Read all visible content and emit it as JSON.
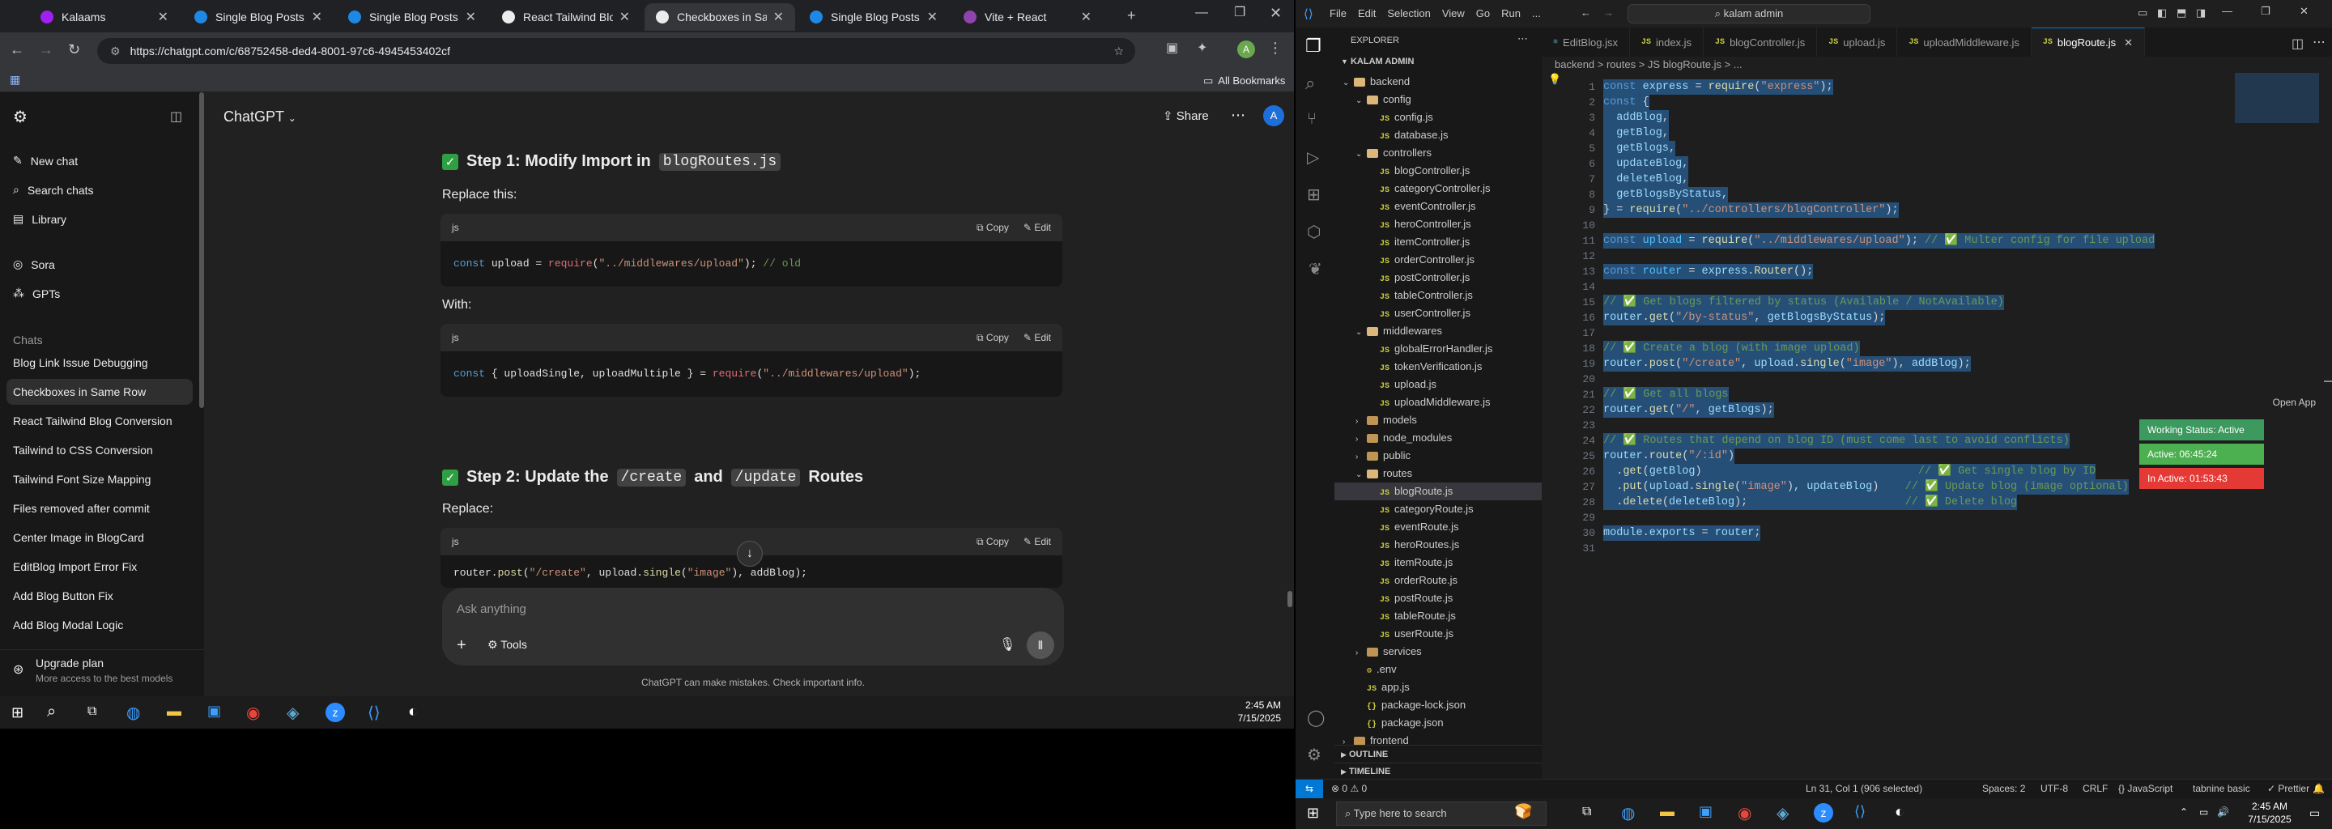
{
  "chrome": {
    "tabs": [
      {
        "label": "Kalaams",
        "color": "#a020f0"
      },
      {
        "label": "Single Blog Posts Pag",
        "color": "#1e88e5"
      },
      {
        "label": "Single Blog Posts Pag",
        "color": "#1e88e5"
      },
      {
        "label": "React Tailwind Blog Co",
        "color": "#ececec"
      },
      {
        "label": "Checkboxes in Same R",
        "color": "#ececec"
      },
      {
        "label": "Single Blog Posts Pag",
        "color": "#1e88e5"
      },
      {
        "label": "Vite + React",
        "color": "#8e44ad"
      }
    ],
    "url": "https://chatgpt.com/c/68752458-ded4-8001-97c6-4945453402cf",
    "all_bookmarks": "All Bookmarks",
    "profile_initial": "A"
  },
  "chatgpt": {
    "sidebar": {
      "new_chat": "New chat",
      "search_chats": "Search chats",
      "library": "Library",
      "sora": "Sora",
      "gpts": "GPTs",
      "chats_heading": "Chats",
      "chats": [
        "Blog Link Issue Debugging",
        "Checkboxes in Same Row",
        "React Tailwind Blog Conversion",
        "Tailwind to CSS Conversion",
        "Tailwind Font Size Mapping",
        "Files removed after commit",
        "Center Image in BlogCard",
        "EditBlog Import Error Fix",
        "Add Blog Button Fix",
        "Add Blog Modal Logic"
      ],
      "upgrade_title": "Upgrade plan",
      "upgrade_sub": "More access to the best models"
    },
    "header": {
      "model": "ChatGPT",
      "share": "Share",
      "avatar": "A"
    },
    "content": {
      "step1_prefix": "Step 1: Modify Import in",
      "step1_code": "blogRoutes.js",
      "replace_this": "Replace this:",
      "with": "With:",
      "step2_prefix": "Step 2: Update the",
      "step2_code1": "/create",
      "step2_and": "and",
      "step2_code2": "/update",
      "step2_suffix": "Routes",
      "replace": "Replace:",
      "lang": "js",
      "copy": "Copy",
      "edit": "Edit"
    },
    "composer": {
      "placeholder": "Ask anything",
      "tools": "Tools"
    },
    "disclaimer": "ChatGPT can make mistakes. Check important info."
  },
  "taskbar_left": {
    "time": "2:45 AM",
    "date": "7/15/2025"
  },
  "vscode": {
    "menu": [
      "File",
      "Edit",
      "Selection",
      "View",
      "Go",
      "Run",
      "..."
    ],
    "search": "kalam admin",
    "explorer_title": "EXPLORER",
    "root": "KALAM ADMIN",
    "tree": [
      {
        "label": "backend",
        "depth": 0,
        "type": "folder",
        "open": true
      },
      {
        "label": "config",
        "depth": 1,
        "type": "folder",
        "open": true
      },
      {
        "label": "config.js",
        "depth": 2,
        "type": "js"
      },
      {
        "label": "database.js",
        "depth": 2,
        "type": "js"
      },
      {
        "label": "controllers",
        "depth": 1,
        "type": "folder",
        "open": true
      },
      {
        "label": "blogController.js",
        "depth": 2,
        "type": "js"
      },
      {
        "label": "categoryController.js",
        "depth": 2,
        "type": "js"
      },
      {
        "label": "eventController.js",
        "depth": 2,
        "type": "js"
      },
      {
        "label": "heroController.js",
        "depth": 2,
        "type": "js"
      },
      {
        "label": "itemController.js",
        "depth": 2,
        "type": "js"
      },
      {
        "label": "orderController.js",
        "depth": 2,
        "type": "js"
      },
      {
        "label": "postController.js",
        "depth": 2,
        "type": "js"
      },
      {
        "label": "tableController.js",
        "depth": 2,
        "type": "js"
      },
      {
        "label": "userController.js",
        "depth": 2,
        "type": "js"
      },
      {
        "label": "middlewares",
        "depth": 1,
        "type": "folder",
        "open": true
      },
      {
        "label": "globalErrorHandler.js",
        "depth": 2,
        "type": "js"
      },
      {
        "label": "tokenVerification.js",
        "depth": 2,
        "type": "js"
      },
      {
        "label": "upload.js",
        "depth": 2,
        "type": "js"
      },
      {
        "label": "uploadMiddleware.js",
        "depth": 2,
        "type": "js"
      },
      {
        "label": "models",
        "depth": 1,
        "type": "folder",
        "open": false
      },
      {
        "label": "node_modules",
        "depth": 1,
        "type": "folder",
        "open": false
      },
      {
        "label": "public",
        "depth": 1,
        "type": "folder",
        "open": false
      },
      {
        "label": "routes",
        "depth": 1,
        "type": "folder",
        "open": true
      },
      {
        "label": "blogRoute.js",
        "depth": 2,
        "type": "js",
        "selected": true
      },
      {
        "label": "categoryRoute.js",
        "depth": 2,
        "type": "js"
      },
      {
        "label": "eventRoute.js",
        "depth": 2,
        "type": "js"
      },
      {
        "label": "heroRoutes.js",
        "depth": 2,
        "type": "js"
      },
      {
        "label": "itemRoute.js",
        "depth": 2,
        "type": "js"
      },
      {
        "label": "orderRoute.js",
        "depth": 2,
        "type": "js"
      },
      {
        "label": "postRoute.js",
        "depth": 2,
        "type": "js"
      },
      {
        "label": "tableRoute.js",
        "depth": 2,
        "type": "js"
      },
      {
        "label": "userRoute.js",
        "depth": 2,
        "type": "js"
      },
      {
        "label": "services",
        "depth": 1,
        "type": "folder",
        "open": false
      },
      {
        "label": ".env",
        "depth": 1,
        "type": "env"
      },
      {
        "label": "app.js",
        "depth": 1,
        "type": "js"
      },
      {
        "label": "package-lock.json",
        "depth": 1,
        "type": "json"
      },
      {
        "label": "package.json",
        "depth": 1,
        "type": "json"
      },
      {
        "label": "frontend",
        "depth": 0,
        "type": "folder",
        "open": false
      }
    ],
    "outline": "OUTLINE",
    "timeline": "TIMELINE",
    "tabs": [
      "EditBlog.jsx",
      "index.js",
      "blogController.js",
      "upload.js",
      "uploadMiddleware.js",
      "blogRoute.js"
    ],
    "breadcrumb": "backend > routes > JS blogRoute.js > ...",
    "line_numbers": [
      "1",
      "2",
      "3",
      "4",
      "5",
      "6",
      "7",
      "8",
      "9",
      "10",
      "11",
      "12",
      "13",
      "14",
      "15",
      "16",
      "17",
      "18",
      "19",
      "20",
      "21",
      "22",
      "23",
      "24",
      "25",
      "26",
      "27",
      "28",
      "29",
      "30",
      "31"
    ],
    "open_app": "Open App",
    "status_badges": [
      {
        "label": "Working Status: Active",
        "color": "#3c9a5f"
      },
      {
        "label": "Active: 06:45:24",
        "color": "#4caf50"
      },
      {
        "label": "In Active: 01:53:43",
        "color": "#e53935"
      }
    ],
    "statusbar": {
      "errors": "⊗ 0 ⚠ 0",
      "position": "Ln 31, Col 1 (906 selected)",
      "spaces": "Spaces: 2",
      "encoding": "UTF-8",
      "eol": "CRLF",
      "language": "{} JavaScript",
      "tabnine": "tabnine basic",
      "prettier": "✓ Prettier"
    }
  },
  "taskbar_right": {
    "search": "Type here to search",
    "time": "2:45 AM",
    "date": "7/15/2025"
  }
}
